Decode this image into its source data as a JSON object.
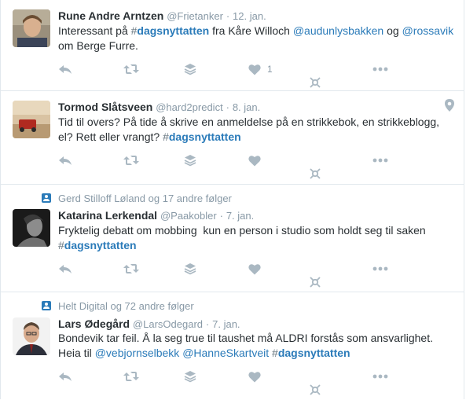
{
  "colors": {
    "link": "#2b7bb9",
    "muted": "#8899a6",
    "icon": "#aab8c2",
    "border": "#e1e8ed"
  },
  "tweets": [
    {
      "fullname": "Rune Andre Arntzen",
      "username": "@Frietanker",
      "dot": "·",
      "time": "12. jan.",
      "text": [
        "Interessant på ",
        "#",
        "dagsnyttatten",
        " fra Kåre Willoch ",
        "@",
        "audunlysbakken",
        " og ",
        "@",
        "rossavik",
        " om Berge Furre."
      ],
      "like_count": "1",
      "icons": [
        "reply-icon",
        "retweet-icon",
        "buffer-icon",
        "like-icon",
        "more-icon",
        "analytics-icon"
      ]
    },
    {
      "fullname": "Tormod Slåtsveen",
      "username": "@hard2predict",
      "dot": "·",
      "time": "8. jan.",
      "text": [
        "Tid til overs? På tide å skrive en anmeldelse på en strikkebok, en strikkeblogg, el? Rett eller vrangt? ",
        "#",
        "dagsnyttatten"
      ],
      "like_count": "",
      "icons": [
        "reply-icon",
        "retweet-icon",
        "buffer-icon",
        "like-icon",
        "more-icon",
        "analytics-icon",
        "location-pin-icon"
      ]
    },
    {
      "context": "Gerd Stilloff Løland og 17 andre følger",
      "fullname": "Katarina Lerkendal",
      "username": "@Paakobler",
      "dot": "·",
      "time": "7. jan.",
      "text": [
        "Fryktelig debatt om mobbing  kun en person i studio som holdt seg til saken ",
        "#",
        "dagsnyttatten"
      ],
      "like_count": "",
      "icons": [
        "reply-icon",
        "retweet-icon",
        "buffer-icon",
        "like-icon",
        "more-icon",
        "analytics-icon"
      ]
    },
    {
      "context": "Helt Digital og 72 andre følger",
      "fullname": "Lars Ødegård",
      "username": "@LarsOdegard",
      "dot": "·",
      "time": "7. jan.",
      "text": [
        "Bondevik tar feil. Å la seg true til taushet må ALDRI forstås som ansvarlighet. Heia til ",
        "@",
        "vebjornselbekk",
        " ",
        "@",
        "HanneSkartveit",
        " ",
        "#",
        "dagsnyttatten"
      ],
      "like_count": "",
      "icons": [
        "reply-icon",
        "retweet-icon",
        "buffer-icon",
        "like-icon",
        "more-icon",
        "analytics-icon"
      ]
    }
  ]
}
